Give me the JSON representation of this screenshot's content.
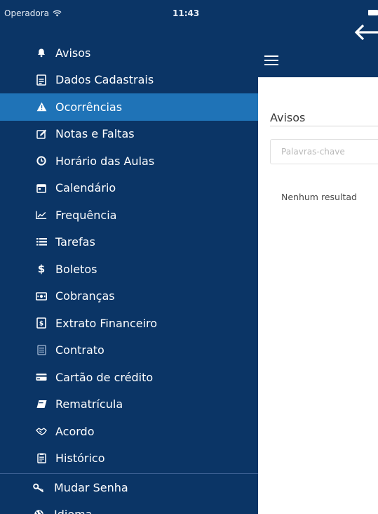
{
  "status_bar": {
    "carrier": "Operadora",
    "time": "11:43"
  },
  "sidebar": {
    "items": [
      {
        "label": "Avisos",
        "icon": "bell-icon",
        "active": false
      },
      {
        "label": "Dados Cadastrais",
        "icon": "document-icon",
        "active": false
      },
      {
        "label": "Ocorrências",
        "icon": "warning-icon",
        "active": true
      },
      {
        "label": "Notas e Faltas",
        "icon": "edit-icon",
        "active": false
      },
      {
        "label": "Horário das Aulas",
        "icon": "clock-icon",
        "active": false
      },
      {
        "label": "Calendário",
        "icon": "calendar-icon",
        "active": false
      },
      {
        "label": "Frequência",
        "icon": "line-chart-icon",
        "active": false
      },
      {
        "label": "Tarefas",
        "icon": "list-icon",
        "active": false
      },
      {
        "label": "Boletos",
        "icon": "dollar-icon",
        "active": false
      },
      {
        "label": "Cobranças",
        "icon": "money-icon",
        "active": false
      },
      {
        "label": "Extrato Financeiro",
        "icon": "statement-icon",
        "active": false
      },
      {
        "label": "Contrato",
        "icon": "contract-icon",
        "active": false
      },
      {
        "label": "Cartão de crédito",
        "icon": "credit-card-icon",
        "active": false
      },
      {
        "label": "Rematrícula",
        "icon": "book-icon",
        "active": false
      },
      {
        "label": "Acordo",
        "icon": "handshake-icon",
        "active": false
      },
      {
        "label": "Histórico",
        "icon": "history-icon",
        "active": false
      }
    ],
    "bottom_items": [
      {
        "label": "Mudar Senha",
        "icon": "key-icon"
      },
      {
        "label": "Idioma",
        "icon": "globe-icon"
      }
    ]
  },
  "main": {
    "section_title": "Avisos",
    "search": {
      "placeholder": "Palavras-chave",
      "value": ""
    },
    "empty_message": "Nenhum resultad"
  },
  "colors": {
    "sidebar_bg": "#0b3566",
    "active_item_bg": "#1f73b7",
    "text_light": "#ffffff"
  }
}
